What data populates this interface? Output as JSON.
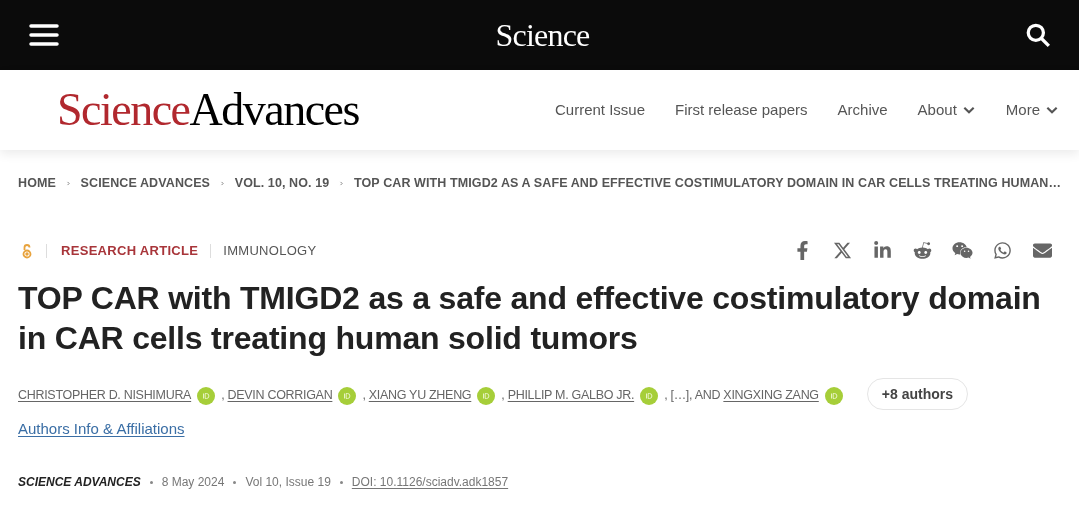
{
  "top_bar": {
    "logo": "Science"
  },
  "masthead": {
    "logo_first": "Science",
    "logo_second": "Advances",
    "nav": [
      {
        "label": "Current Issue",
        "has_menu": false
      },
      {
        "label": "First release papers",
        "has_menu": false
      },
      {
        "label": "Archive",
        "has_menu": false
      },
      {
        "label": "About",
        "has_menu": true
      },
      {
        "label": "More",
        "has_menu": true
      }
    ]
  },
  "breadcrumb": [
    "HOME",
    "SCIENCE ADVANCES",
    "VOL. 10, NO. 19",
    "TOP CAR WITH TMIGD2 AS A SAFE AND EFFECTIVE COSTIMULATORY DOMAIN IN CAR CELLS TREATING HUMAN…"
  ],
  "article": {
    "open_access": true,
    "type": "RESEARCH ARTICLE",
    "subject": "IMMUNOLOGY",
    "title": "TOP CAR with TMIGD2 as a safe and effective costimulatory domain in CAR cells treating human solid tumors",
    "byline": [
      {
        "kind": "author",
        "name": "CHRISTOPHER D. NISHIMURA",
        "orcid": true
      },
      {
        "kind": "text",
        "text": ","
      },
      {
        "kind": "author",
        "name": "DEVIN CORRIGAN",
        "orcid": true
      },
      {
        "kind": "text",
        "text": ","
      },
      {
        "kind": "author",
        "name": "XIANG YU ZHENG",
        "orcid": true
      },
      {
        "kind": "text",
        "text": ","
      },
      {
        "kind": "author",
        "name": "PHILLIP M. GALBO JR.",
        "orcid": true
      },
      {
        "kind": "text",
        "text": ", […], AND"
      },
      {
        "kind": "author",
        "name": "XINGXING ZANG",
        "orcid": true
      }
    ],
    "more_authors": "+8 authors",
    "affiliations_link": "Authors Info & Affiliations",
    "journal": "SCIENCE ADVANCES",
    "date": "8 May 2024",
    "issue": "Vol 10, Issue 19",
    "doi": "DOI: 10.1126/sciadv.adk1857"
  }
}
